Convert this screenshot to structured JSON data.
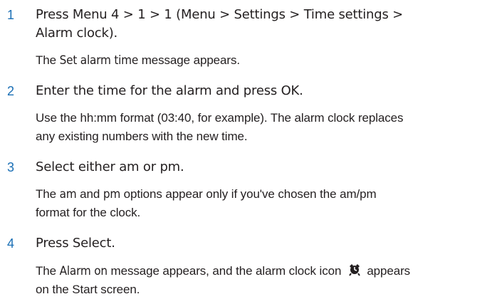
{
  "steps": [
    {
      "number": "1",
      "instruction": {
        "prefix": "Press Menu 4 > 1 > 1 (Menu > Settings > Time settings >",
        "line2": "Alarm clock",
        "suffix": ")."
      },
      "result": {
        "pre": "The ",
        "bold": "Set alarm time",
        "post": " message appears."
      }
    },
    {
      "number": "2",
      "instruction": {
        "prefix": "Enter the time for the alarm and press ",
        "bold": "OK",
        "suffix": "."
      },
      "result": {
        "line1": "Use the hh:mm format (03:40, for example). The alarm clock replaces",
        "line2": "any existing numbers with the new time."
      }
    },
    {
      "number": "3",
      "instruction": {
        "prefix": "Select either ",
        "bold1": "am",
        "middle": " or ",
        "bold2": "pm",
        "suffix": "."
      },
      "result": {
        "pre": "The ",
        "bold1": "am",
        "mid": " and ",
        "bold2": "pm",
        "post": " options appear only if you've chosen the am/pm",
        "line2": "format for the clock."
      }
    },
    {
      "number": "4",
      "instruction": {
        "prefix": "Press ",
        "bold": "Select",
        "suffix": "."
      },
      "result": {
        "pre": "The ",
        "bold": "Alarm on",
        "mid": " message appears, and the alarm clock icon",
        "icon": "alarm-clock-icon",
        "post": "appears",
        "line2": "on the Start screen."
      }
    }
  ],
  "colors": {
    "step_number": "#1a6fb5",
    "text": "#231f20"
  }
}
